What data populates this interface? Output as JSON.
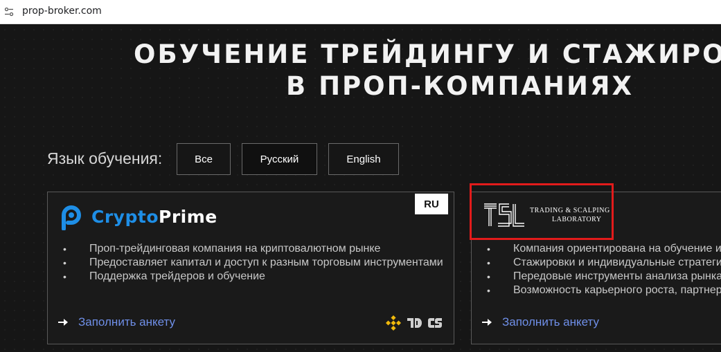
{
  "browser": {
    "url": "prop-broker.com"
  },
  "hero": {
    "line1": "ОБУЧЕНИЕ ТРЕЙДИНГУ И СТАЖИРОВКИ",
    "line2": "В ПРОП-КОМПАНИЯХ"
  },
  "language_filter": {
    "label": "Язык обучения:",
    "options": [
      "Все",
      "Русский",
      "English"
    ],
    "selected": "Русский"
  },
  "cards": [
    {
      "name": {
        "part1": "Crypto",
        "part2": "Prime"
      },
      "badge": "RU",
      "bullets": [
        "Проп-трейдинговая компания на криптовалютном рынке",
        "Предоставляет капитал и доступ к разным торговым инструментами",
        "Поддержка трейдеров и обучение"
      ],
      "cta": "Заполнить анкету",
      "accent": "#1e8ee6"
    },
    {
      "logo_text": {
        "mark": "TSL",
        "line1": "TRADING & SCALPING",
        "line2": "LABORATORY"
      },
      "bullets": [
        "Компания ориентирована на обучение и п",
        "Стажировки и индивидуальные стратегии",
        "Передовые инструменты анализа рынка",
        "Возможность карьерного роста, партнерс"
      ],
      "cta": "Заполнить анкету"
    }
  ]
}
